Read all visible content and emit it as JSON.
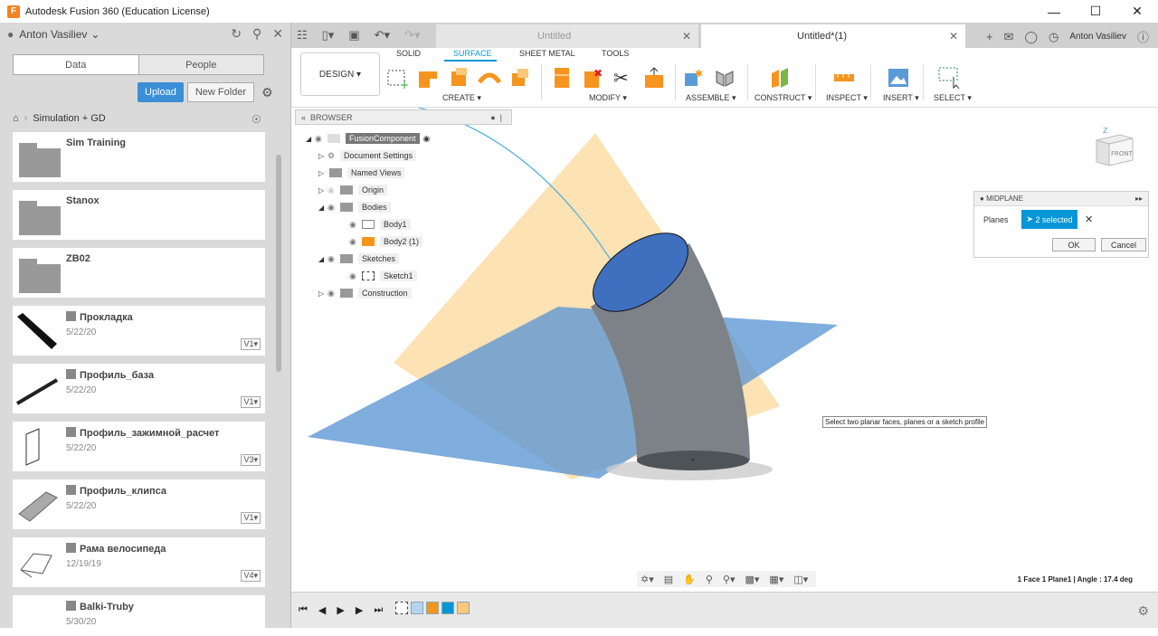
{
  "window": {
    "title": "Autodesk Fusion 360 (Education License)",
    "app_icon": "F"
  },
  "left_panel": {
    "user": "Anton Vasiliev",
    "tabs": [
      "Data",
      "People"
    ],
    "upload_label": "Upload",
    "new_folder_label": "New Folder",
    "breadcrumb": "Simulation + GD",
    "items": [
      {
        "name": "Sim Training",
        "type": "folder"
      },
      {
        "name": "Stanox",
        "type": "folder"
      },
      {
        "name": "ZB02",
        "type": "folder"
      },
      {
        "name": "Прокладка",
        "date": "5/22/20",
        "version": "V1"
      },
      {
        "name": "Профиль_база",
        "date": "5/22/20",
        "version": "V1"
      },
      {
        "name": "Профиль_зажимной_расчет",
        "date": "5/22/20",
        "version": "V3"
      },
      {
        "name": "Профиль_клипса",
        "date": "5/22/20",
        "version": "V1"
      },
      {
        "name": "Рама велосипеда",
        "date": "12/19/19",
        "version": "V4"
      },
      {
        "name": "Balki-Truby",
        "date": "5/30/20",
        "version": ""
      }
    ]
  },
  "doc_tabs": [
    {
      "label": "Untitled"
    },
    {
      "label": "Untitled*(1)"
    }
  ],
  "user_short": "Anton Vasiliev",
  "toolbar": {
    "design": "DESIGN",
    "workspace_tabs": [
      "SOLID",
      "SURFACE",
      "SHEET METAL",
      "TOOLS"
    ],
    "active_tab": "SURFACE",
    "groups": [
      "CREATE",
      "MODIFY",
      "ASSEMBLE",
      "CONSTRUCT",
      "INSPECT",
      "INSERT",
      "SELECT"
    ]
  },
  "browser": {
    "title": "BROWSER",
    "rows": [
      "FusionComponent",
      "Document Settings",
      "Named Views",
      "Origin",
      "Bodies",
      "Body1",
      "Body2 (1)",
      "Sketches",
      "Sketch1",
      "Construction"
    ]
  },
  "midplane": {
    "title": "MIDPLANE",
    "planes_label": "Planes",
    "selected": "2 selected",
    "ok": "OK",
    "cancel": "Cancel"
  },
  "tooltip": "Select two planar faces, planes or a sketch profile",
  "status": "1 Face 1 Plane1 | Angle : 17.4 deg",
  "viewcube": {
    "label": "FRONT",
    "axis": "Z"
  }
}
